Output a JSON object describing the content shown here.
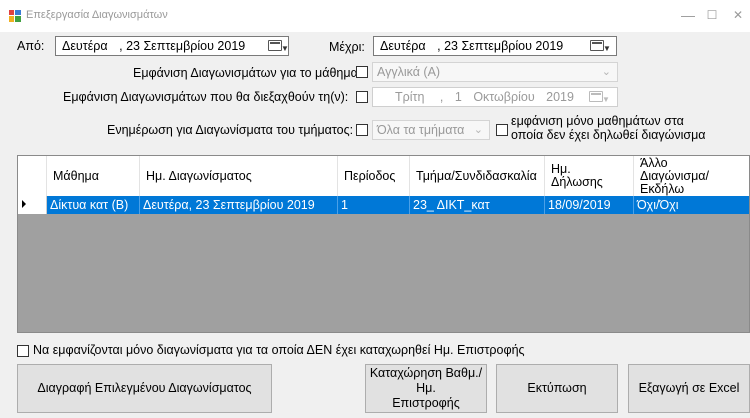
{
  "window": {
    "title": "Επεξεργασία Διαγωνισμάτων",
    "minimize": "—",
    "maximize": "☐",
    "close": "✕"
  },
  "filters": {
    "from_label": "Από:",
    "from_date": {
      "day": "Δευτέρα",
      "sep": ",",
      "date": "23 Σεπτεμβρίου 2019"
    },
    "to_label": "Μέχρι:",
    "to_date": {
      "day": "Δευτέρα",
      "sep": ",",
      "date": "23 Σεπτεμβρίου 2019"
    },
    "subject_label": "Εμφάνιση Διαγωνισμάτων για το μάθημα:",
    "subject_value": "Αγγλικά (Α)",
    "upcoming_label": "Εμφάνιση Διαγωνισμάτων που θα διεξαχθούν τη(ν):",
    "upcoming_date": {
      "day": "Τρίτη",
      "sep": ",",
      "num": "1",
      "month": "Οκτωβρίου",
      "year": "2019"
    },
    "dept_label": "Ενημέρωση για Διαγωνίσματα του τμήματος:",
    "dept_value": "Όλα τα τμήματα",
    "only_subjects_line1": "εμφάνιση μόνο μαθημάτων στα",
    "only_subjects_line2": "οποία δεν έχει δηλωθεί διαγώνισμα"
  },
  "table": {
    "columns": [
      {
        "label": "Μάθημα"
      },
      {
        "label": "Ημ. Διαγωνίσματος"
      },
      {
        "label": "Περίοδος"
      },
      {
        "label": "Τμήμα/Συνδιδασκαλία"
      },
      {
        "label": "Ημ.\nΔήλωσης"
      },
      {
        "label": "Άλλο\nΔιαγώνισμα/Εκδήλω"
      }
    ],
    "rows": [
      [
        "Δίκτυα κατ (Β)",
        "Δευτέρα, 23 Σεπτεμβρίου 2019",
        "1",
        "23_ ΔΙΚΤ_κατ",
        "18/09/2019",
        "Όχι/Όχι"
      ]
    ]
  },
  "no_return_label": "Να εμφανίζονται μόνο διαγωνίσματα για τα οποία ΔΕΝ έχει καταχωρηθεί Ημ. Επιστροφής",
  "buttons": {
    "delete": "Διαγραφή Επιλεγμένου Διαγωνίσματος",
    "grade_line1": "Καταχώρηση Βαθμ./Ημ.",
    "grade_line2": "Επιστροφής",
    "print": "Εκτύπωση",
    "export": "Εξαγωγή σε Excel"
  },
  "colors": {
    "selection": "#0078d7",
    "grid_bg": "#a0a0a0",
    "window_bg": "#f0f0f0"
  }
}
